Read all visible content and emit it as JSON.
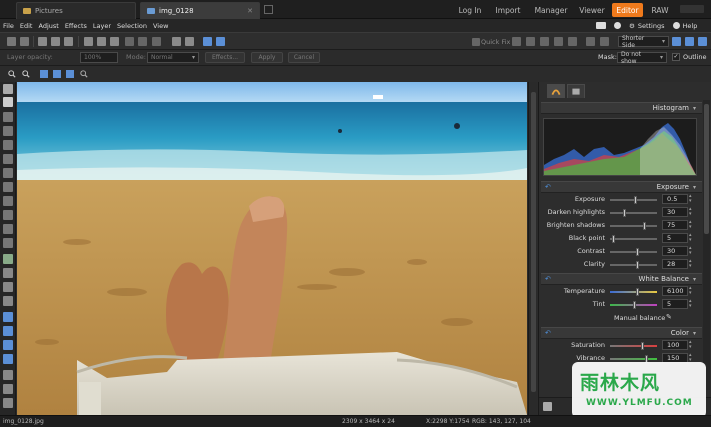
{
  "tabs": [
    {
      "label": "Pictures",
      "icon": "folder-icon"
    },
    {
      "label": "img_0128",
      "icon": "image-icon"
    }
  ],
  "modes": [
    "Log In",
    "Import",
    "Manager",
    "Viewer",
    "Editor",
    "RAW"
  ],
  "active_mode": "Editor",
  "menu": [
    "File",
    "Edit",
    "Adjust",
    "Effects",
    "Layer",
    "Selection",
    "View"
  ],
  "menu_right": {
    "settings": "Settings",
    "help": "Help"
  },
  "toolbar": {
    "quick_fix": "Quick Fix",
    "fit_mode": "Shorter Side"
  },
  "options": {
    "layer_opacity_label": "Layer opacity:",
    "layer_opacity_value": "100%",
    "mode_label": "Mode:",
    "mode_value": "Normal",
    "effects_button": "Effects...",
    "apply_button": "Apply",
    "cancel_button": "Cancel",
    "mask_label": "Mask:",
    "mask_value": "Do not show",
    "outline_label": "Outline",
    "outline_checked": true
  },
  "panel": {
    "histogram_title": "Histogram",
    "exposure_title": "Exposure",
    "white_balance_title": "White Balance",
    "color_title": "Color",
    "manual_balance_label": "Manual balance",
    "exposure_sliders": [
      {
        "label": "Exposure",
        "value": "0.5",
        "level": 0.55
      },
      {
        "label": "Darken highlights",
        "value": "30",
        "level": 0.3
      },
      {
        "label": "Brighten shadows",
        "value": "75",
        "level": 0.75
      },
      {
        "label": "Black point",
        "value": "5",
        "level": 0.05
      },
      {
        "label": "Contrast",
        "value": "30",
        "level": 0.6
      },
      {
        "label": "Clarity",
        "value": "28",
        "level": 0.6
      }
    ],
    "wb_sliders": [
      {
        "label": "Temperature",
        "value": "6100",
        "level": 0.6
      },
      {
        "label": "Tint",
        "value": "5",
        "level": 0.52
      }
    ],
    "color_sliders": [
      {
        "label": "Saturation",
        "value": "100",
        "level": 0.7
      },
      {
        "label": "Vibrance",
        "value": "150",
        "level": 0.8
      }
    ]
  },
  "status": {
    "filename": "img_0128.jpg",
    "dimensions": "2309 x 3464 x 24",
    "coords": "X:2298 Y:1754",
    "rgb": "RGB: 143, 127, 104"
  },
  "watermark": {
    "line1": "雨林木风",
    "line2": "WWW.YLMFU.COM"
  },
  "colors": {
    "accent": "#f07a1c",
    "watermark": "#2aa84a"
  }
}
